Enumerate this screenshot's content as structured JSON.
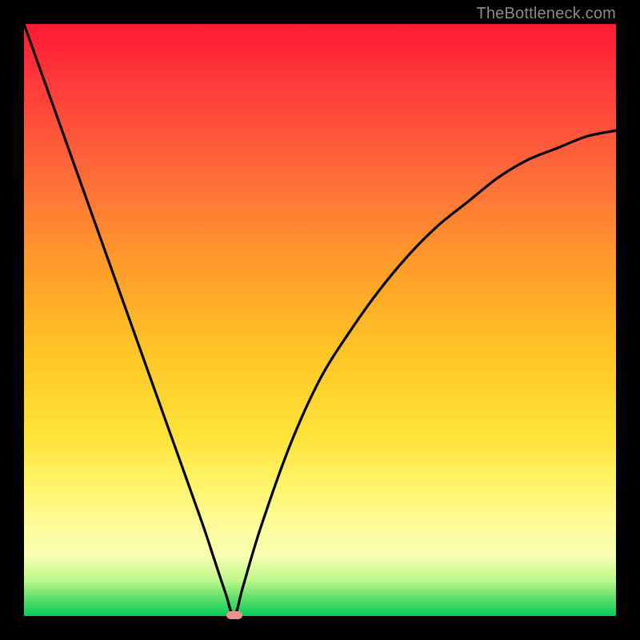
{
  "watermark": "TheBottleneck.com",
  "chart_data": {
    "type": "line",
    "title": "",
    "xlabel": "",
    "ylabel": "",
    "xlim": [
      0,
      100
    ],
    "ylim": [
      0,
      100
    ],
    "series": [
      {
        "name": "bottleneck-curve",
        "x": [
          0,
          5,
          10,
          15,
          20,
          25,
          30,
          32,
          34,
          35.5,
          37,
          40,
          45,
          50,
          55,
          60,
          65,
          70,
          75,
          80,
          85,
          90,
          95,
          100
        ],
        "y": [
          100,
          86,
          72,
          58,
          44,
          30,
          16,
          10,
          4,
          0,
          5,
          15,
          29,
          40,
          48,
          55,
          61,
          66,
          70,
          74,
          77,
          79,
          81,
          82
        ]
      }
    ],
    "annotations": [
      {
        "name": "optimal-marker",
        "x": 35.5,
        "y": 0
      }
    ],
    "background_gradient": {
      "direction": "vertical",
      "stops": [
        {
          "pos": 0.0,
          "color": "#ff1a33"
        },
        {
          "pos": 0.4,
          "color": "#ff9a2a"
        },
        {
          "pos": 0.7,
          "color": "#ffe43a"
        },
        {
          "pos": 0.9,
          "color": "#f7ffb0"
        },
        {
          "pos": 1.0,
          "color": "#08c95e"
        }
      ]
    }
  }
}
